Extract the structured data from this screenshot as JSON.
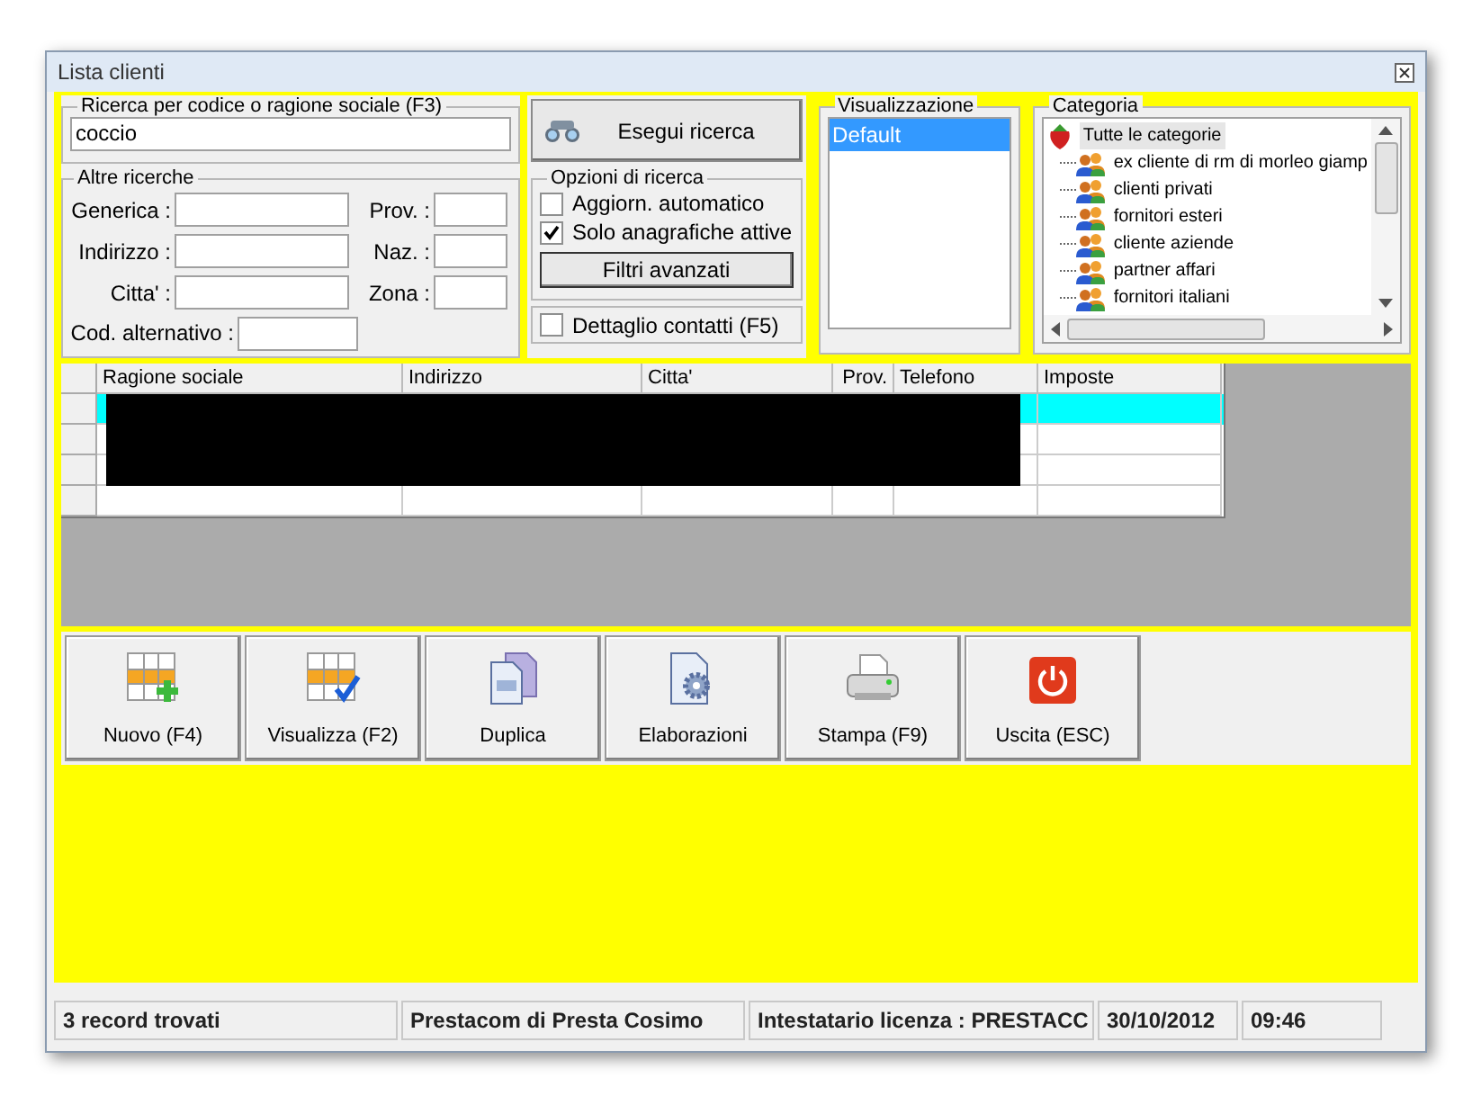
{
  "window": {
    "title": "Lista clienti"
  },
  "search": {
    "legend": "Ricerca per codice o ragione sociale (F3)",
    "value": "coccio"
  },
  "search_button": {
    "label": "Esegui ricerca"
  },
  "other_searches": {
    "legend": "Altre ricerche",
    "fields": [
      {
        "label": "Generica :",
        "kind": "wide"
      },
      {
        "label": "Prov. :",
        "kind": "short"
      },
      {
        "label": "Indirizzo :",
        "kind": "wide"
      },
      {
        "label": "Naz. :",
        "kind": "short"
      },
      {
        "label": "Citta' :",
        "kind": "wide"
      },
      {
        "label": "Zona :",
        "kind": "short"
      },
      {
        "label": "Cod. alternativo :",
        "kind": "alt"
      }
    ]
  },
  "search_options": {
    "legend": "Opzioni di ricerca",
    "checkboxes": [
      {
        "label": "Aggiorn. automatico",
        "checked": false
      },
      {
        "label": "Solo anagrafiche attive",
        "checked": true
      }
    ],
    "button": "Filtri avanzati"
  },
  "contacts_detail": {
    "label": "Dettaglio contatti (F5)",
    "checked": false
  },
  "view": {
    "legend": "Visualizzazione",
    "items": [
      {
        "label": "Default",
        "selected": true
      }
    ]
  },
  "category": {
    "legend": "Categoria",
    "root": {
      "label": "Tutte le categorie",
      "selected": true
    },
    "items": [
      {
        "label": "ex cliente di rm di morleo giamp",
        "selected": false
      },
      {
        "label": "clienti privati",
        "selected": false
      },
      {
        "label": "fornitori esteri",
        "selected": false
      },
      {
        "label": "cliente aziende",
        "selected": false
      },
      {
        "label": "partner affari",
        "selected": false
      },
      {
        "label": "fornitori italiani",
        "selected": false
      }
    ]
  },
  "table": {
    "columns": [
      "Ragione sociale",
      "Indirizzo",
      "Citta'",
      "Prov.",
      "Telefono",
      "Imposte"
    ],
    "rows": [
      {
        "selected": true,
        "redacted": true
      },
      {
        "selected": false,
        "redacted": true
      },
      {
        "selected": false,
        "redacted": true
      },
      {
        "selected": false,
        "redacted": false
      }
    ]
  },
  "toolbar": [
    {
      "label": "Nuovo (F4)",
      "kind": "new"
    },
    {
      "label": "Visualizza (F2)",
      "kind": "view"
    },
    {
      "label": "Duplica",
      "kind": "duplicate"
    },
    {
      "label": "Elaborazioni",
      "kind": "process"
    },
    {
      "label": "Stampa (F9)",
      "kind": "print"
    },
    {
      "label": "Uscita (ESC)",
      "kind": "exit"
    }
  ],
  "status_bar": [
    "3 record trovati",
    "Prestacom di Presta Cosimo",
    "Intestatario licenza : PRESTACC",
    "30/10/2012",
    "09:46"
  ]
}
